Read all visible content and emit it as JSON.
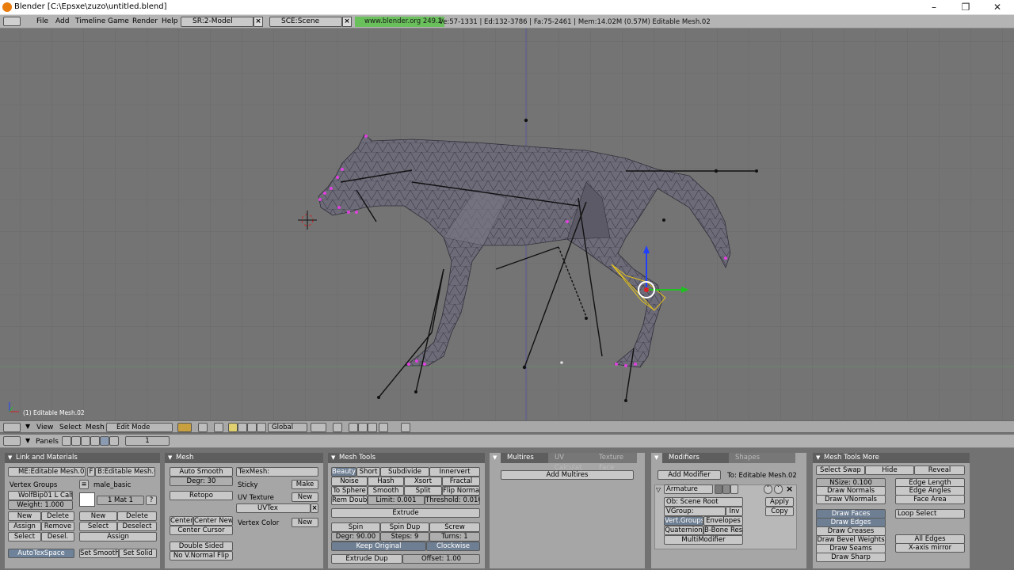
{
  "window": {
    "title": "Blender [C:\\Epsxe\\zuzo\\untitled.blend]",
    "minimize": "–",
    "maximize": "❐",
    "close": "✕"
  },
  "topbar": {
    "menu": [
      "File",
      "Add",
      "Timeline",
      "Game",
      "Render",
      "Help"
    ],
    "screen": "SR:2-Model",
    "scene": "SCE:Scene",
    "url": "www.blender.org 249.2",
    "stats": "Ve:57-1331 | Ed:132-3786 | Fa:75-2461 | Mem:14.02M (0.57M) Editable Mesh.02"
  },
  "viewport": {
    "object_label": "(1) Editable Mesh.02"
  },
  "view_header": {
    "menus": [
      "View",
      "Select",
      "Mesh"
    ],
    "mode": "Edit Mode",
    "orientation": "Global"
  },
  "panels_header": {
    "label": "Panels",
    "frame": "1"
  },
  "link_materials": {
    "title": "Link and Materials",
    "me_name": "ME:Editable Mesh.02",
    "f": "F",
    "ob_name": "B:Editable Mesh.02",
    "vertex_groups": "Vertex Groups",
    "group_name": "male_basic",
    "vgroup": "WolfBip01 L Calf",
    "weight": "Weight: 1.000",
    "mat": "1 Mat 1",
    "q": "?",
    "btn_new": "New",
    "btn_delete": "Delete",
    "btn_assign": "Assign",
    "btn_remove": "Remove",
    "btn_select": "Select",
    "btn_desel": "Desel.",
    "btn_new2": "New",
    "btn_delete2": "Delete",
    "btn_select2": "Select",
    "btn_deselect2": "Deselect",
    "btn_assign2": "Assign",
    "autotex": "AutoTexSpace",
    "set_smooth": "Set Smooth",
    "set_solid": "Set Solid"
  },
  "mesh": {
    "title": "Mesh",
    "auto_smooth": "Auto Smooth",
    "degr": "Degr: 30",
    "retopo": "Retopo",
    "center": "Center",
    "center_new": "Center New",
    "center_cursor": "Center Cursor",
    "double_sided": "Double Sided",
    "no_vnormal": "No V.Normal Flip",
    "texmesh": "TexMesh:",
    "sticky": "Sticky",
    "make": "Make",
    "uv_texture": "UV Texture",
    "new1": "New",
    "uvtex": "UVTex",
    "vertex_color": "Vertex Color",
    "new2": "New"
  },
  "mesh_tools": {
    "title": "Mesh Tools",
    "row1": [
      "Beauty",
      "Short",
      "Subdivide",
      "Innervert"
    ],
    "row2": [
      "Noise",
      "Hash",
      "Xsort",
      "Fractal"
    ],
    "row3": [
      "To Sphere",
      "Smooth",
      "Split",
      "Flip Normal"
    ],
    "rem_doubl": "Rem Doubl",
    "limit": "Limit: 0.001",
    "threshold": "Threshold: 0.010",
    "extrude": "Extrude",
    "spin": "Spin",
    "spin_dup": "Spin Dup",
    "screw": "Screw",
    "degr": "Degr: 90.00",
    "steps": "Steps: 9",
    "turns": "Turns: 1",
    "keep_original": "Keep Original",
    "clockwise": "Clockwise",
    "extrude_dup": "Extrude Dup",
    "offset": "Offset: 1.00"
  },
  "multires": {
    "tabs": [
      "Multires",
      "UV Calculat",
      "Texture Face"
    ],
    "add": "Add Multires"
  },
  "modifiers": {
    "tabs": [
      "Modifiers",
      "Shapes"
    ],
    "add": "Add Modifier",
    "to": "To: Editable Mesh.02",
    "armature": "Armature",
    "ob": "Ob: Scene Root",
    "vgroup": "VGroup:",
    "inv": "Inv",
    "vert_groups": "Vert.Groups",
    "envelopes": "Envelopes",
    "quaternion": "Quaternion",
    "bbone": "B-Bone Res",
    "multimodifier": "MultiModifier",
    "apply": "Apply",
    "copy": "Copy"
  },
  "mesh_tools_more": {
    "title": "Mesh Tools More",
    "select_swap": "Select Swap",
    "hide": "Hide",
    "reveal": "Reveal",
    "nsize": "NSize: 0.100",
    "draw_normals": "Draw Normals",
    "draw_vnormals": "Draw VNormals",
    "edge_length": "Edge Length",
    "edge_angles": "Edge Angles",
    "face_area": "Face Area",
    "draw_faces": "Draw Faces",
    "draw_edges": "Draw Edges",
    "draw_creases": "Draw Creases",
    "draw_bevel": "Draw Bevel Weights",
    "draw_seams": "Draw Seams",
    "draw_sharp": "Draw Sharp",
    "loop_select": "Loop Select",
    "all_edges": "All Edges",
    "xaxis": "X-axis mirror"
  },
  "colors": {
    "viewport_bg": "#747474",
    "mesh_fill": "#6d6b78",
    "selected_vertex": "#e040e0",
    "bone": "#111111",
    "manip_x": "#20c020",
    "manip_z": "#2040ff",
    "url_green": "#6ac15c"
  }
}
